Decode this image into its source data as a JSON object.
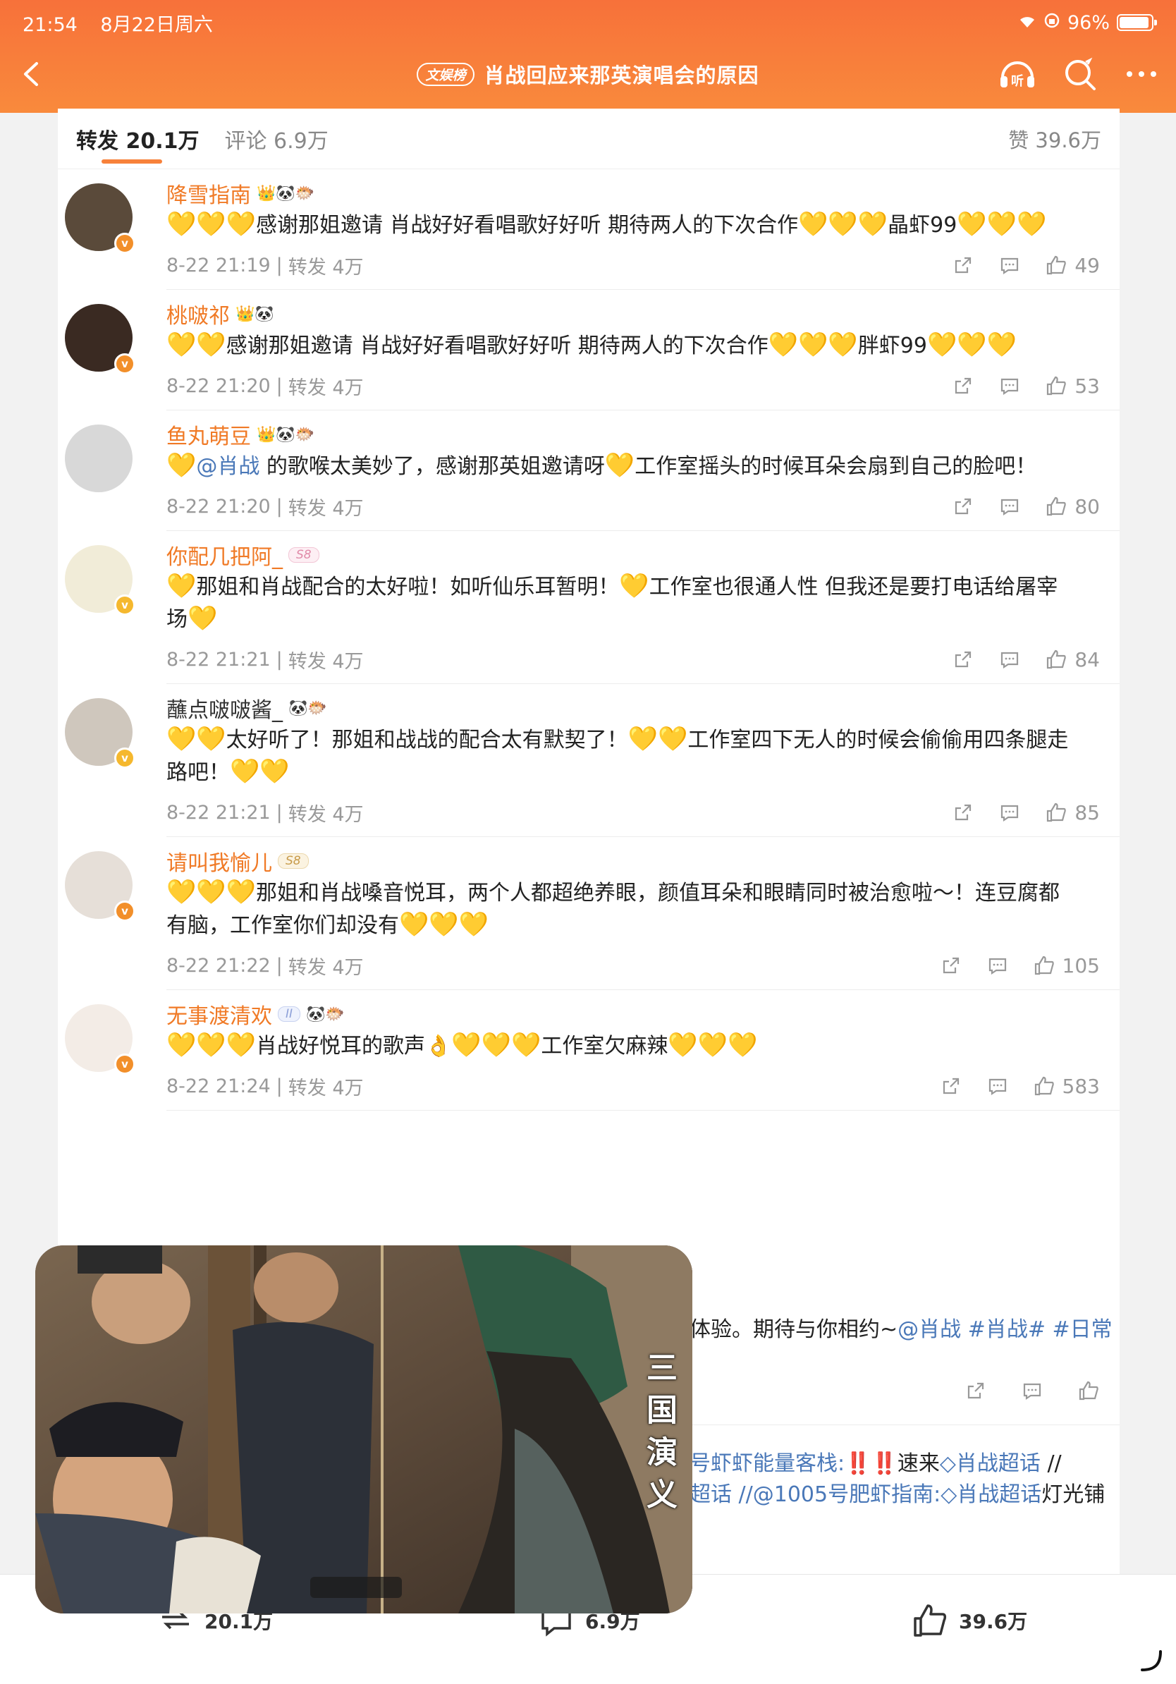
{
  "status": {
    "time": "21:54",
    "date": "8月22日周六",
    "battery": "96%"
  },
  "nav": {
    "badge": "文娱榜",
    "title": "肖战回应来那英演唱会的原因",
    "listen_label": "听"
  },
  "tabs": {
    "repost": "转发 20.1万",
    "comment": "评论 6.9万",
    "likes_total": "赞 39.6万"
  },
  "reposts": [
    {
      "name": "降雪指南",
      "medals": "👑🐼🐡",
      "text": [
        [
          "h",
          "💛💛💛"
        ],
        [
          "t",
          "感谢那姐邀请 肖战好好看唱歌好好听 期待两人的下次合作"
        ],
        [
          "h",
          "💛💛💛"
        ],
        [
          "t",
          "晶虾99"
        ],
        [
          "h",
          "💛💛💛"
        ]
      ],
      "time": "8-22 21:19",
      "repost": "转发 4万",
      "likes": "49",
      "vip": "v",
      "av": "#5a4a3a"
    },
    {
      "name": "桃啵祁",
      "medals": "👑🐼",
      "text": [
        [
          "h",
          "💛💛"
        ],
        [
          "t",
          "感谢那姐邀请 肖战好好看唱歌好好听 期待两人的下次合作"
        ],
        [
          "h",
          "💛💛💛"
        ],
        [
          "t",
          "胖虾99"
        ],
        [
          "h",
          "💛💛💛"
        ]
      ],
      "time": "8-22 21:20",
      "repost": "转发 4万",
      "likes": "53",
      "vip": "v",
      "av": "#3a2a22"
    },
    {
      "name": "鱼丸萌豆",
      "medals": "👑🐼🐡",
      "text": [
        [
          "h",
          "💛"
        ],
        [
          "a",
          "@肖战"
        ],
        [
          "t",
          " 的歌喉太美妙了，感谢那英姐邀请呀"
        ],
        [
          "h",
          "💛"
        ],
        [
          "t",
          "工作室摇头的时候耳朵会扇到自己的脸吧！"
        ]
      ],
      "time": "8-22 21:20",
      "repost": "转发 4万",
      "likes": "80",
      "vip": "",
      "av": "#d8d8d8"
    },
    {
      "name": "你配几把阿_",
      "medals": "",
      "lvl": "S8",
      "lvl_style": "pink",
      "text": [
        [
          "h",
          "💛"
        ],
        [
          "t",
          "那姐和肖战配合的太好啦！如听仙乐耳暂明！"
        ],
        [
          "h",
          "💛"
        ],
        [
          "t",
          "工作室也很通人性 但我还是要打电话给屠宰场"
        ],
        [
          "h",
          "💛"
        ]
      ],
      "time": "8-22 21:21",
      "repost": "转发 4万",
      "likes": "84",
      "vip": "g",
      "av": "#f1ecd8"
    },
    {
      "name": "蘸点啵啵酱_",
      "medals": "🐼🐡",
      "plain": true,
      "text": [
        [
          "h",
          "💛💛"
        ],
        [
          "t",
          "太好听了！那姐和战战的配合太有默契了！"
        ],
        [
          "h",
          "💛💛"
        ],
        [
          "t",
          "工作室四下无人的时候会偷偷用四条腿走路吧！"
        ],
        [
          "h",
          "💛💛"
        ]
      ],
      "time": "8-22 21:21",
      "repost": "转发 4万",
      "likes": "85",
      "vip": "g",
      "av": "#cfc7bd"
    },
    {
      "name": "请叫我愉儿",
      "medals": "",
      "lvl": "S8",
      "lvl_style": "gold",
      "text": [
        [
          "h",
          "💛💛💛"
        ],
        [
          "t",
          "那姐和肖战嗓音悦耳，两个人都超绝养眼，颜值耳朵和眼睛同时被治愈啦～！连豆腐都有脑，工作室你们却没有"
        ],
        [
          "h",
          "💛💛💛"
        ]
      ],
      "time": "8-22 21:22",
      "repost": "转发 4万",
      "likes": "105",
      "vip": "v",
      "av": "#e6dfd8"
    },
    {
      "name": "无事渡清欢",
      "medals": "🐼🐡",
      "lvl": "II",
      "lvl_style": "blue",
      "text": [
        [
          "h",
          "💛💛💛"
        ],
        [
          "t",
          "肖战好悦耳的歌声"
        ],
        [
          "e",
          "👌"
        ],
        [
          "h",
          "💛💛💛"
        ],
        [
          "t",
          "工作室欠麻辣"
        ],
        [
          "h",
          "💛💛💛"
        ]
      ],
      "time": "8-22 21:24",
      "repost": "转发 4万",
      "likes": "583",
      "vip": "v",
      "av": "#f3ece6"
    }
  ],
  "under": {
    "line1_pre": "体验。期待与你相约~",
    "line1_tags": "@肖战 #肖战# #日常",
    "line2_a": "号虾虾能量客栈:",
    "line2_marks": "‼️‼️",
    "line2_b": "速来",
    "line2_tag": "肖战超话",
    "line2_c": " //",
    "line3_a": "超话 //@1005号肥虾指南:",
    "line3_tag": "肖战超话",
    "line3_b": "灯光铺"
  },
  "bottom": {
    "repost": "20.1万",
    "comment": "6.9万",
    "likes": "39.6万"
  },
  "pip": {
    "caption": "三国演义"
  }
}
